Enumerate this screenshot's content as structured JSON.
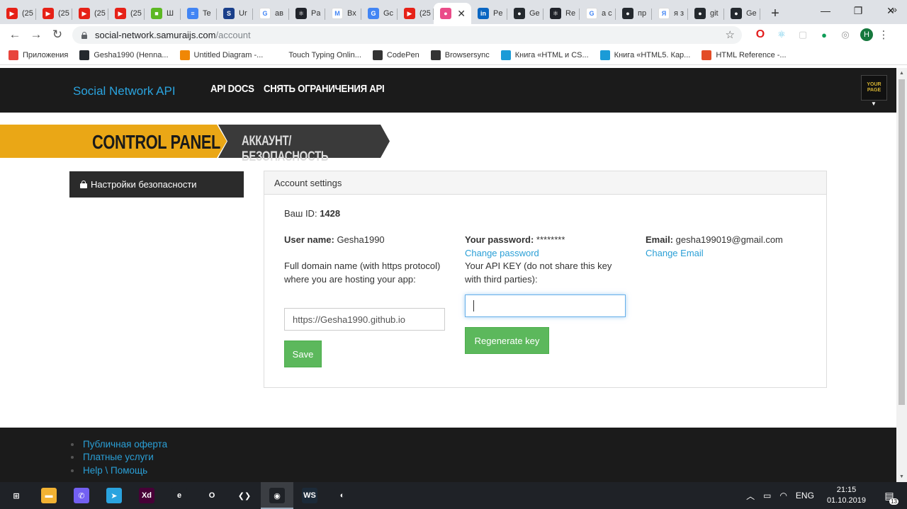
{
  "browser": {
    "tabs": [
      {
        "label": "(25",
        "icon": "youtube-icon",
        "color": "#e62117",
        "glyph": "▶"
      },
      {
        "label": "(25",
        "icon": "youtube-icon",
        "color": "#e62117",
        "glyph": "▶"
      },
      {
        "label": "(25",
        "icon": "youtube-icon",
        "color": "#e62117",
        "glyph": "▶"
      },
      {
        "label": "(25",
        "icon": "youtube-icon",
        "color": "#e62117",
        "glyph": "▶"
      },
      {
        "label": "Ш",
        "icon": "cube-icon",
        "color": "#5cb823",
        "glyph": "■"
      },
      {
        "label": "Te",
        "icon": "docs-icon",
        "color": "#4285f4",
        "glyph": "≡"
      },
      {
        "label": "Ur",
        "icon": "sandbox-icon",
        "color": "#1a3f8a",
        "glyph": "S"
      },
      {
        "label": "ав",
        "icon": "google-icon",
        "color": "#ffffff",
        "glyph": "G"
      },
      {
        "label": "Pa",
        "icon": "react-icon",
        "color": "#20232a",
        "glyph": "⚛"
      },
      {
        "label": "Вх",
        "icon": "gmail-icon",
        "color": "#ffffff",
        "glyph": "M"
      },
      {
        "label": "Gc",
        "icon": "translate-icon",
        "color": "#4285f4",
        "glyph": "G"
      },
      {
        "label": "(25",
        "icon": "youtube-icon",
        "color": "#e62117",
        "glyph": "▶"
      },
      {
        "label": "",
        "icon": "dribbble-icon",
        "color": "#ea4c89",
        "glyph": "●",
        "active": true
      },
      {
        "label": "Pe",
        "icon": "linkedin-icon",
        "color": "#0a66c2",
        "glyph": "in"
      },
      {
        "label": "Ge",
        "icon": "github-icon",
        "color": "#24292e",
        "glyph": "●"
      },
      {
        "label": "Re",
        "icon": "react-icon",
        "color": "#20232a",
        "glyph": "⚛"
      },
      {
        "label": "a c",
        "icon": "google-icon",
        "color": "#ffffff",
        "glyph": "G"
      },
      {
        "label": "пр",
        "icon": "github-icon",
        "color": "#24292e",
        "glyph": "●"
      },
      {
        "label": "я з",
        "icon": "yandex-icon",
        "color": "#ffffff",
        "glyph": "Я"
      },
      {
        "label": "git",
        "icon": "github-icon",
        "color": "#24292e",
        "glyph": "●"
      },
      {
        "label": "Ge",
        "icon": "github-icon",
        "color": "#24292e",
        "glyph": "●"
      }
    ],
    "new_tab": "+",
    "url_host": "social-network.samuraijs.com",
    "url_path": "/account",
    "profile_initial": "H",
    "bookmarks": [
      {
        "label": "Приложения",
        "icon": "apps-grid-icon",
        "color": "#e8453c"
      },
      {
        "label": "Gesha1990 (Henna...",
        "icon": "github-icon",
        "color": "#24292e"
      },
      {
        "label": "Untitled Diagram -...",
        "icon": "drawio-icon",
        "color": "#f08705"
      },
      {
        "label": "Touch Typing Onlin...",
        "icon": "blank-page-icon",
        "color": "#ffffff"
      },
      {
        "label": "CodePen",
        "icon": "codepen-icon",
        "color": "#333333"
      },
      {
        "label": "Browsersync",
        "icon": "browsersync-icon",
        "color": "#333333"
      },
      {
        "label": "Книга «HTML и CS...",
        "icon": "book-icon",
        "color": "#1a9bd7"
      },
      {
        "label": "Книга «HTML5. Кар...",
        "icon": "book-icon",
        "color": "#1a9bd7"
      },
      {
        "label": "HTML Reference -...",
        "icon": "html-ref-icon",
        "color": "#e34c26"
      }
    ],
    "bookmarks_more": "»"
  },
  "site": {
    "logo": "Social Network API",
    "nav": {
      "api_docs": "API DOCS",
      "limits": "СНЯТЬ ОГРАНИЧЕНИЯ API"
    },
    "avatar_text": "YOUR PAGE",
    "banner": {
      "title": "CONTROL PANEL",
      "subtitle": "АККАУНТ/БЕЗОПАСНОСТЬ"
    },
    "side_menu": {
      "security": "Настройки безопасности"
    },
    "panel": {
      "title": "Account settings",
      "id_label": "Ваш ID:",
      "id_value": "1428",
      "username_label": "User name:",
      "username_value": "Gesha1990",
      "domain_label": "Full domain name (with https protocol) where you are hosting your app:",
      "domain_value": "https://Gesha1990.github.io",
      "save": "Save",
      "password_label": "Your password:",
      "password_value": "********",
      "change_password": "Change password",
      "apikey_label": "Your API KEY (do not share this key with third parties):",
      "apikey_value": "",
      "regenerate": "Regenerate key",
      "email_label": "Email:",
      "email_value": "gesha199019@gmail.com",
      "change_email": "Change Email"
    },
    "footer": [
      "Публичная оферта",
      "Платные услуги",
      "Help \\ Помощь"
    ]
  },
  "taskbar": {
    "apps": [
      {
        "name": "windows-start-icon",
        "color": "#1f2227",
        "glyph": "⊞"
      },
      {
        "name": "file-explorer-icon",
        "color": "#f2b233",
        "glyph": "▬"
      },
      {
        "name": "viber-icon",
        "color": "#7360f2",
        "glyph": "✆"
      },
      {
        "name": "telegram-icon",
        "color": "#2aa3df",
        "glyph": "➤"
      },
      {
        "name": "adobe-xd-icon",
        "color": "#470137",
        "glyph": "Xd"
      },
      {
        "name": "edge-icon",
        "color": "#1f2227",
        "glyph": "e"
      },
      {
        "name": "opera-icon",
        "color": "#1f2227",
        "glyph": "O"
      },
      {
        "name": "vscode-icon",
        "color": "#1f2227",
        "glyph": "❮❯"
      },
      {
        "name": "chrome-icon",
        "color": "#1f2227",
        "glyph": "◉",
        "active": true
      },
      {
        "name": "webstorm-icon",
        "color": "#1c2a38",
        "glyph": "WS"
      },
      {
        "name": "firefox-icon",
        "color": "#1f2227",
        "glyph": "◐"
      }
    ],
    "lang": "ENG",
    "time": "21:15",
    "date": "01.10.2019",
    "notifications": "13"
  }
}
